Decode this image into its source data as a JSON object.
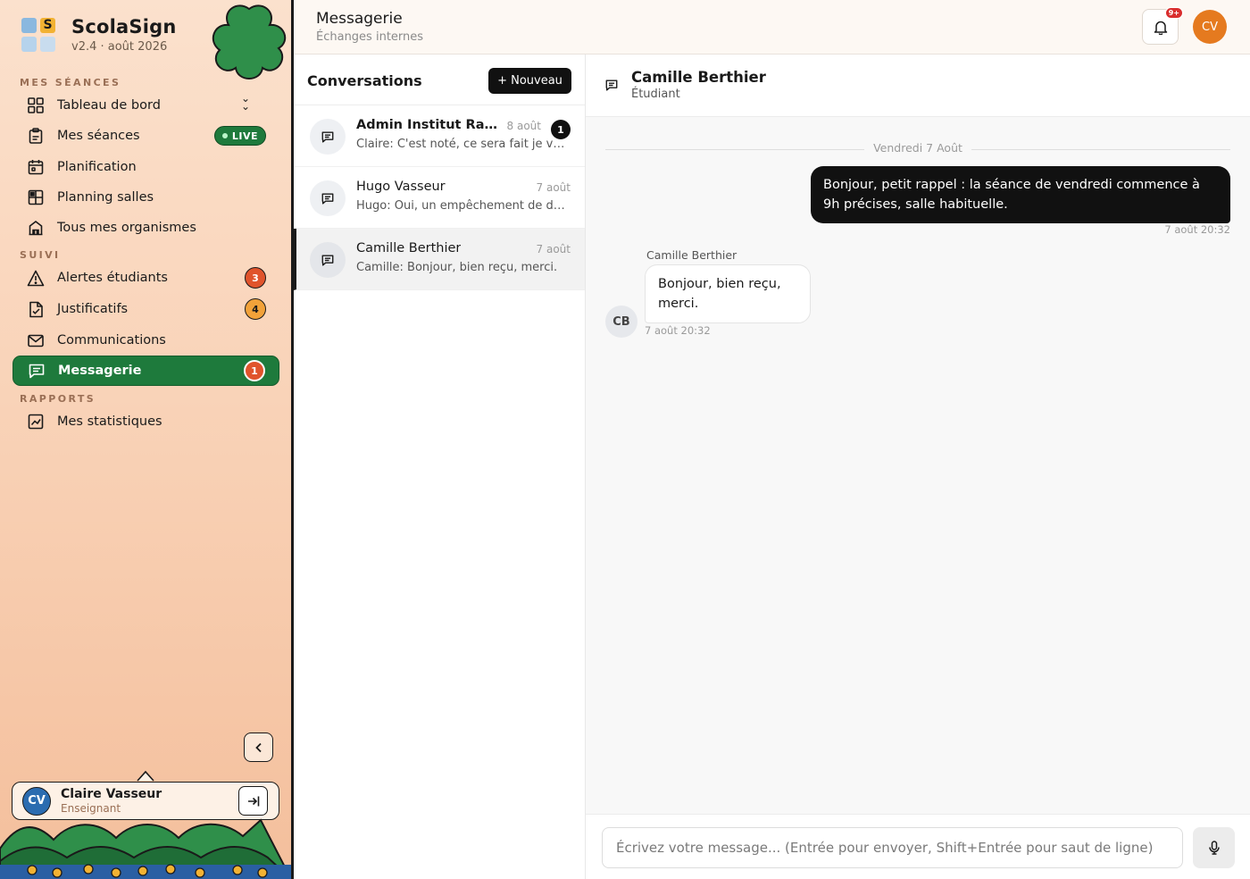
{
  "brand": {
    "name": "ScolaSign",
    "version": "v2.4 · août 2026",
    "logo_letter": "S"
  },
  "sidebar": {
    "sections": [
      {
        "label": "MES SÉANCES"
      },
      {
        "label": "SUIVI"
      },
      {
        "label": "RAPPORTS"
      }
    ],
    "items": [
      {
        "label": "Tableau de bord",
        "icon": "grid-icon"
      },
      {
        "label": "Mes séances",
        "icon": "clipboard-icon",
        "pill": "LIVE"
      },
      {
        "label": "Planification",
        "icon": "calendar-icon"
      },
      {
        "label": "Planning salles",
        "icon": "table-grid-icon"
      },
      {
        "label": "Tous mes organismes",
        "icon": "building-icon"
      },
      {
        "label": "Alertes étudiants",
        "icon": "alert-triangle-icon",
        "badge": "3"
      },
      {
        "label": "Justificatifs",
        "icon": "file-check-icon",
        "badge": "4"
      },
      {
        "label": "Communications",
        "icon": "mail-icon"
      },
      {
        "label": "Messagerie",
        "icon": "message-icon",
        "badge": "1",
        "active": true
      },
      {
        "label": "Mes statistiques",
        "icon": "chart-icon"
      }
    ],
    "user": {
      "initials": "CV",
      "name": "Claire Vasseur",
      "role": "Enseignant"
    }
  },
  "topbar": {
    "title": "Messagerie",
    "subtitle": "Échanges internes",
    "notif_badge": "9+",
    "avatar_initials": "CV"
  },
  "conversations": {
    "title": "Conversations",
    "new_label": "+ Nouveau",
    "items": [
      {
        "name": "Admin Institut Ravel de Lyon",
        "date": "8 août",
        "preview": "Claire: C'est noté, ce sera fait je vous remercie",
        "unread": "1"
      },
      {
        "name": "Hugo Vasseur",
        "date": "7 août",
        "preview": "Hugo: Oui, un empêchement de dernière minute"
      },
      {
        "name": "Camille Berthier",
        "date": "7 août",
        "preview": "Camille: Bonjour, bien reçu, merci.",
        "selected": true
      }
    ]
  },
  "chat": {
    "contact_name": "Camille Berthier",
    "contact_role": "Étudiant",
    "day_separator": "Vendredi 7 Août",
    "messages": [
      {
        "direction": "out",
        "text": "Bonjour, petit rappel : la séance de vendredi commence à 9h précises, salle habituelle.",
        "time": "7 août 20:32"
      },
      {
        "direction": "in",
        "sender": "Camille Berthier",
        "initials": "CB",
        "text": "Bonjour, bien reçu, merci.",
        "time": "7 août 20:32"
      }
    ],
    "composer_placeholder": "Écrivez votre message... (Entrée pour envoyer, Shift+Entrée pour saut de ligne)"
  },
  "colors": {
    "accent_green": "#1e7a3c",
    "badge_red": "#e0542c",
    "badge_orange": "#f2a23a",
    "avatar_orange": "#e57a1f",
    "dark": "#111111"
  }
}
